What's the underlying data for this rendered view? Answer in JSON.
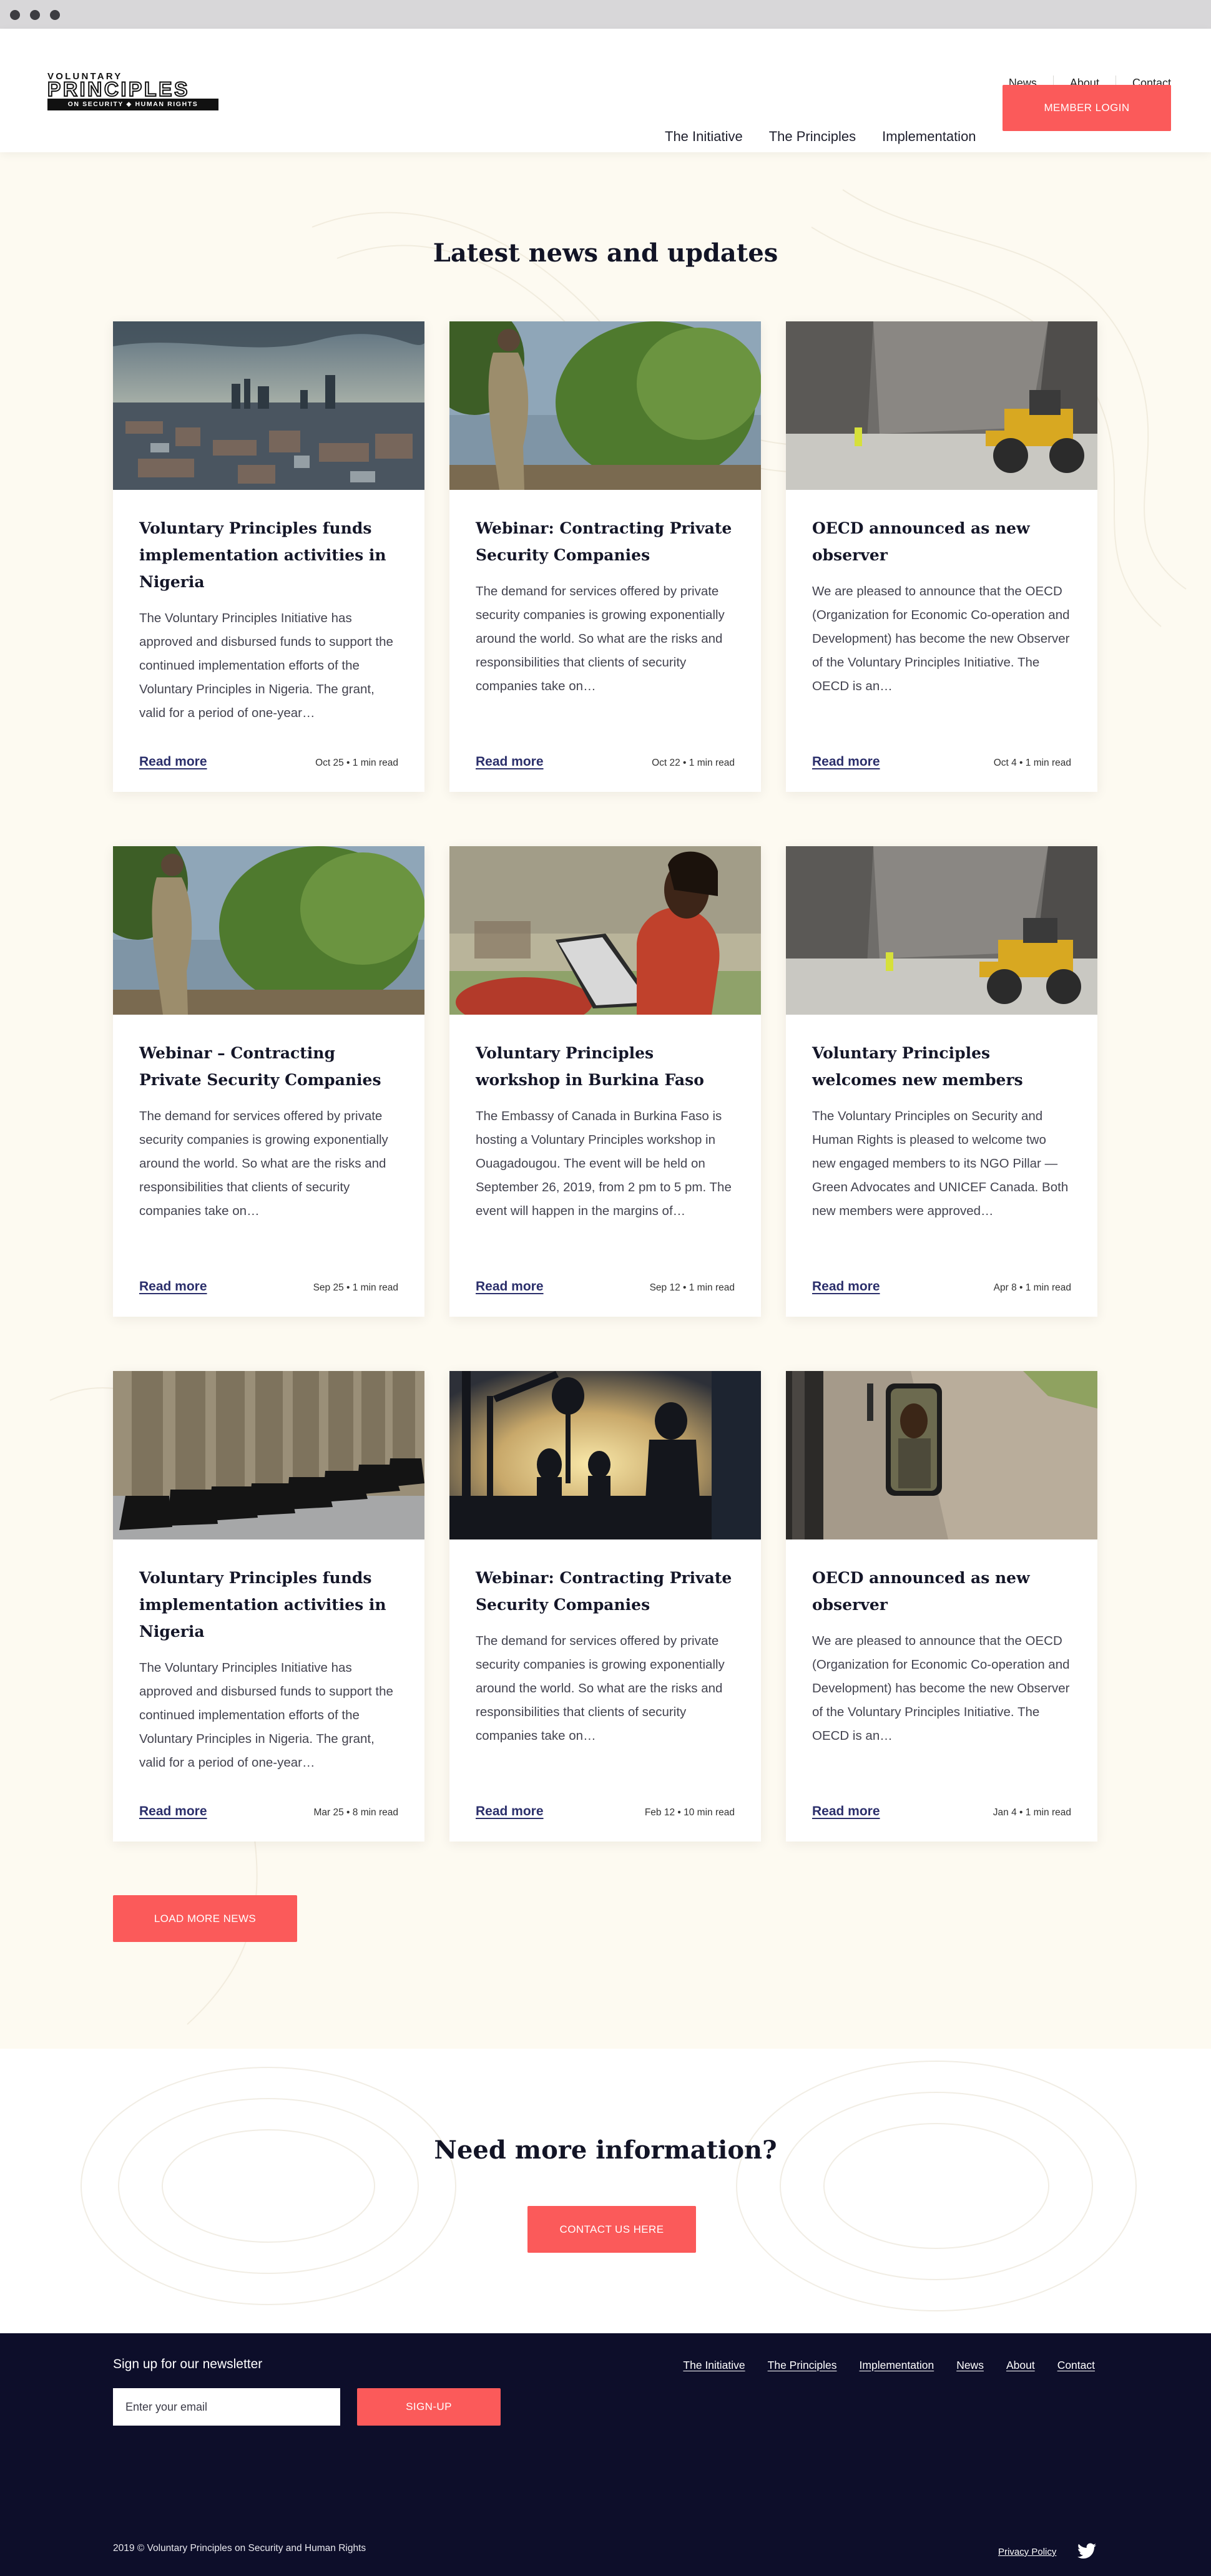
{
  "header": {
    "logo": {
      "line1": "VOLUNTARY",
      "line2": "PRINCIPLES",
      "line3": "ON SECURITY ◆ HUMAN RIGHTS"
    },
    "util_nav": [
      "News",
      "About",
      "Contact"
    ],
    "main_nav": [
      "The Initiative",
      "The Principles",
      "Implementation"
    ],
    "member_login": "MEMBER LOGIN"
  },
  "news": {
    "title": "Latest news and updates",
    "read_more_label": "Read more",
    "cards": [
      {
        "title": "Voluntary Principles funds implementation activities in Nigeria",
        "excerpt": "The Voluntary Principles Initiative has approved and disbursed funds to support the continued implementation efforts of the Voluntary Principles in Nigeria. The grant, valid for a period of one-year…",
        "meta": "Oct 25 • 1 min read",
        "image": "city-skyline"
      },
      {
        "title": "Webinar: Contracting Private Security Companies",
        "excerpt": "The demand for services offered by private security companies is growing exponentially around the world. So what are the risks and responsibilities that clients of security companies take on…",
        "meta": "Oct 22 • 1 min read",
        "image": "soldier-riverbank"
      },
      {
        "title": "OECD announced as new observer",
        "excerpt": "We are pleased to announce that the OECD (Organization for Economic Co-operation and Development) has become the new Observer of the Voluntary Principles Initiative. The OECD is an…",
        "meta": "Oct 4 • 1 min read",
        "image": "quarry-loader"
      },
      {
        "title": "Webinar – Contracting Private Security Companies",
        "excerpt": "The demand for services offered by private security companies is growing exponentially around the world. So what are the risks and responsibilities that clients of security companies take on…",
        "meta": "Sep 25 • 1 min read",
        "image": "soldier-riverbank"
      },
      {
        "title": "Voluntary Principles workshop in Burkina Faso",
        "excerpt": "The Embassy of Canada in Burkina Faso is hosting a Voluntary Principles workshop in Ouagadougou. The event will be held on September 26, 2019, from 2 pm to 5 pm. The event will happen in the margins of…",
        "meta": "Sep 12 • 1 min read",
        "image": "woman-laptop"
      },
      {
        "title": "Voluntary Principles welcomes new members",
        "excerpt": "The Voluntary Principles on Security and Human Rights is pleased to welcome two new engaged members to its NGO Pillar — Green Advocates and UNICEF Canada. Both new members were approved…",
        "meta": "Apr 8 • 1 min read",
        "image": "quarry-loader"
      },
      {
        "title": "Voluntary Principles funds implementation activities in Nigeria",
        "excerpt": "The Voluntary Principles Initiative has approved and disbursed funds to support the continued implementation efforts of the Voluntary Principles in Nigeria. The grant, valid for a period of one-year…",
        "meta": "Mar 25 • 8 min read",
        "image": "soldiers-boots"
      },
      {
        "title": "Webinar: Contracting Private Security Companies",
        "excerpt": "The demand for services offered by private security companies is growing exponentially around the world. So what are the risks and responsibilities that clients of security companies take on…",
        "meta": "Feb 12 • 10 min read",
        "image": "oil-workers-silhouette"
      },
      {
        "title": "OECD announced as new observer",
        "excerpt": "We are pleased to announce that the OECD (Organization for Economic Co-operation and Development) has become the new Observer of the Voluntary Principles Initiative. The OECD is an…",
        "meta": "Jan 4 • 1 min read",
        "image": "truck-mirror"
      }
    ],
    "load_more": "LOAD MORE NEWS"
  },
  "info": {
    "title": "Need more information?",
    "contact_button": "CONTACT US HERE"
  },
  "footer": {
    "newsletter_label": "Sign up for our newsletter",
    "email_placeholder": "Enter your email",
    "signup_button": "SIGN-UP",
    "links": [
      "The Initiative",
      "The Principles",
      "Implementation",
      "News",
      "About",
      "Contact"
    ],
    "copyright": "2019 © Voluntary Principles on Security and Human Rights",
    "privacy": "Privacy Policy"
  },
  "colors": {
    "accent": "#fb5a5a",
    "background": "#fdfaf1",
    "footer": "#0d0e2a",
    "link": "#2b2f6b"
  }
}
